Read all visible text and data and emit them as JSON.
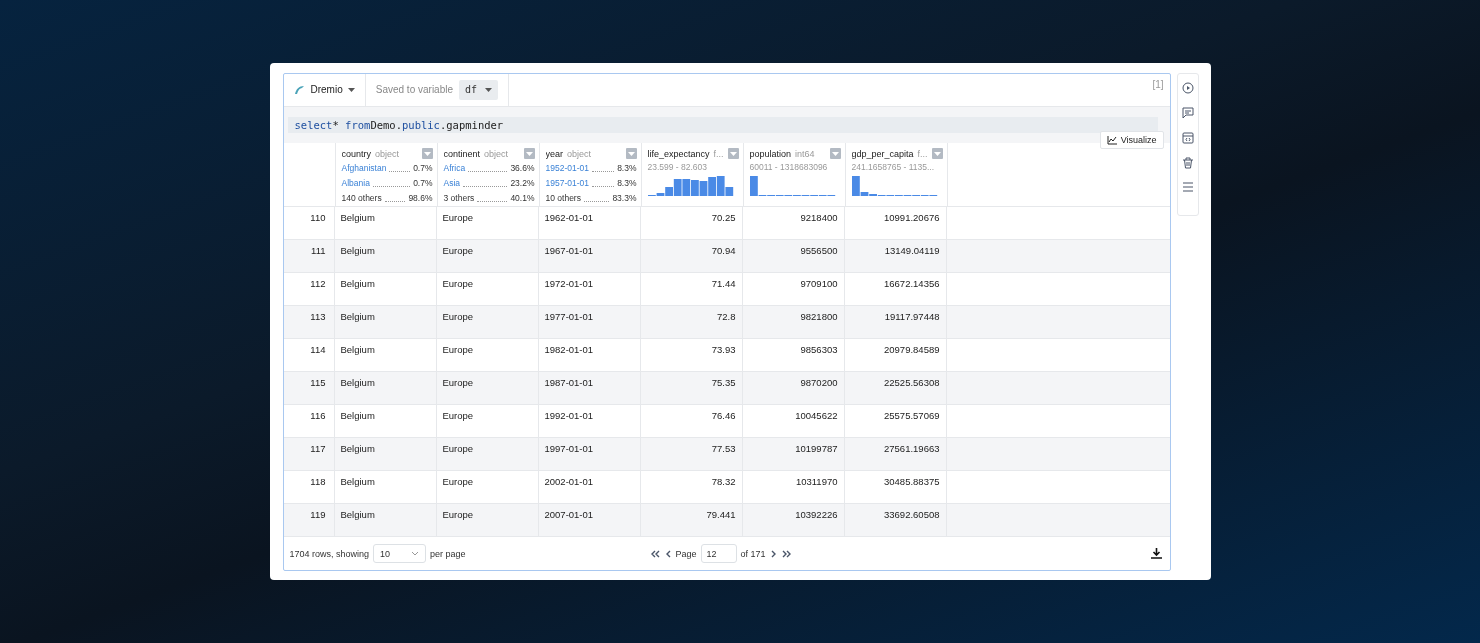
{
  "toolbar": {
    "source": "Dremio",
    "saved_label": "Saved to variable",
    "variable": "df",
    "execution_count": "[1]"
  },
  "query": {
    "keyword_select": "select",
    "star": "*",
    "keyword_from": "from",
    "table_db": "Demo",
    "dot1": ".",
    "schema": "public",
    "dot2": ".",
    "table": "gapminder"
  },
  "visualize_button": "Visualize",
  "columns": [
    {
      "name": "country",
      "dtype": "object",
      "kind": "categorical",
      "stats": [
        {
          "label": "Afghanistan",
          "pct": "0.7%",
          "link": true
        },
        {
          "label": "Albania",
          "pct": "0.7%",
          "link": true
        },
        {
          "label": "140 others",
          "pct": "98.6%",
          "link": false
        }
      ]
    },
    {
      "name": "continent",
      "dtype": "object",
      "kind": "categorical",
      "stats": [
        {
          "label": "Africa",
          "pct": "36.6%",
          "link": true
        },
        {
          "label": "Asia",
          "pct": "23.2%",
          "link": true
        },
        {
          "label": "3 others",
          "pct": "40.1%",
          "link": false
        }
      ]
    },
    {
      "name": "year",
      "dtype": "object",
      "kind": "categorical",
      "stats": [
        {
          "label": "1952-01-01",
          "pct": "8.3%",
          "link": true
        },
        {
          "label": "1957-01-01",
          "pct": "8.3%",
          "link": true
        },
        {
          "label": "10 others",
          "pct": "83.3%",
          "link": false
        }
      ]
    },
    {
      "name": "life_expectancy",
      "dtype": "f...",
      "kind": "numeric",
      "range": "23.599 - 82.603"
    },
    {
      "name": "population",
      "dtype": "int64",
      "kind": "numeric",
      "range": "60011 - 1318683096"
    },
    {
      "name": "gdp_per_capita",
      "dtype": "f...",
      "kind": "numeric",
      "range": "241.1658765 - 1135..."
    }
  ],
  "rows": [
    {
      "index": "110",
      "cells": [
        "Belgium",
        "Europe",
        "1962-01-01",
        "70.25",
        "9218400",
        "10991.20676"
      ]
    },
    {
      "index": "111",
      "cells": [
        "Belgium",
        "Europe",
        "1967-01-01",
        "70.94",
        "9556500",
        "13149.04119"
      ]
    },
    {
      "index": "112",
      "cells": [
        "Belgium",
        "Europe",
        "1972-01-01",
        "71.44",
        "9709100",
        "16672.14356"
      ]
    },
    {
      "index": "113",
      "cells": [
        "Belgium",
        "Europe",
        "1977-01-01",
        "72.8",
        "9821800",
        "19117.97448"
      ]
    },
    {
      "index": "114",
      "cells": [
        "Belgium",
        "Europe",
        "1982-01-01",
        "73.93",
        "9856303",
        "20979.84589"
      ]
    },
    {
      "index": "115",
      "cells": [
        "Belgium",
        "Europe",
        "1987-01-01",
        "75.35",
        "9870200",
        "22525.56308"
      ]
    },
    {
      "index": "116",
      "cells": [
        "Belgium",
        "Europe",
        "1992-01-01",
        "76.46",
        "10045622",
        "25575.57069"
      ]
    },
    {
      "index": "117",
      "cells": [
        "Belgium",
        "Europe",
        "1997-01-01",
        "77.53",
        "10199787",
        "27561.19663"
      ]
    },
    {
      "index": "118",
      "cells": [
        "Belgium",
        "Europe",
        "2002-01-01",
        "78.32",
        "10311970",
        "30485.88375"
      ]
    },
    {
      "index": "119",
      "cells": [
        "Belgium",
        "Europe",
        "2007-01-01",
        "79.441",
        "10392226",
        "33692.60508"
      ]
    }
  ],
  "footer": {
    "rows_label": "1704 rows, showing",
    "page_size": "10",
    "per_page": "per page",
    "page_label": "Page",
    "page": "12",
    "of_pages": "of 171"
  }
}
